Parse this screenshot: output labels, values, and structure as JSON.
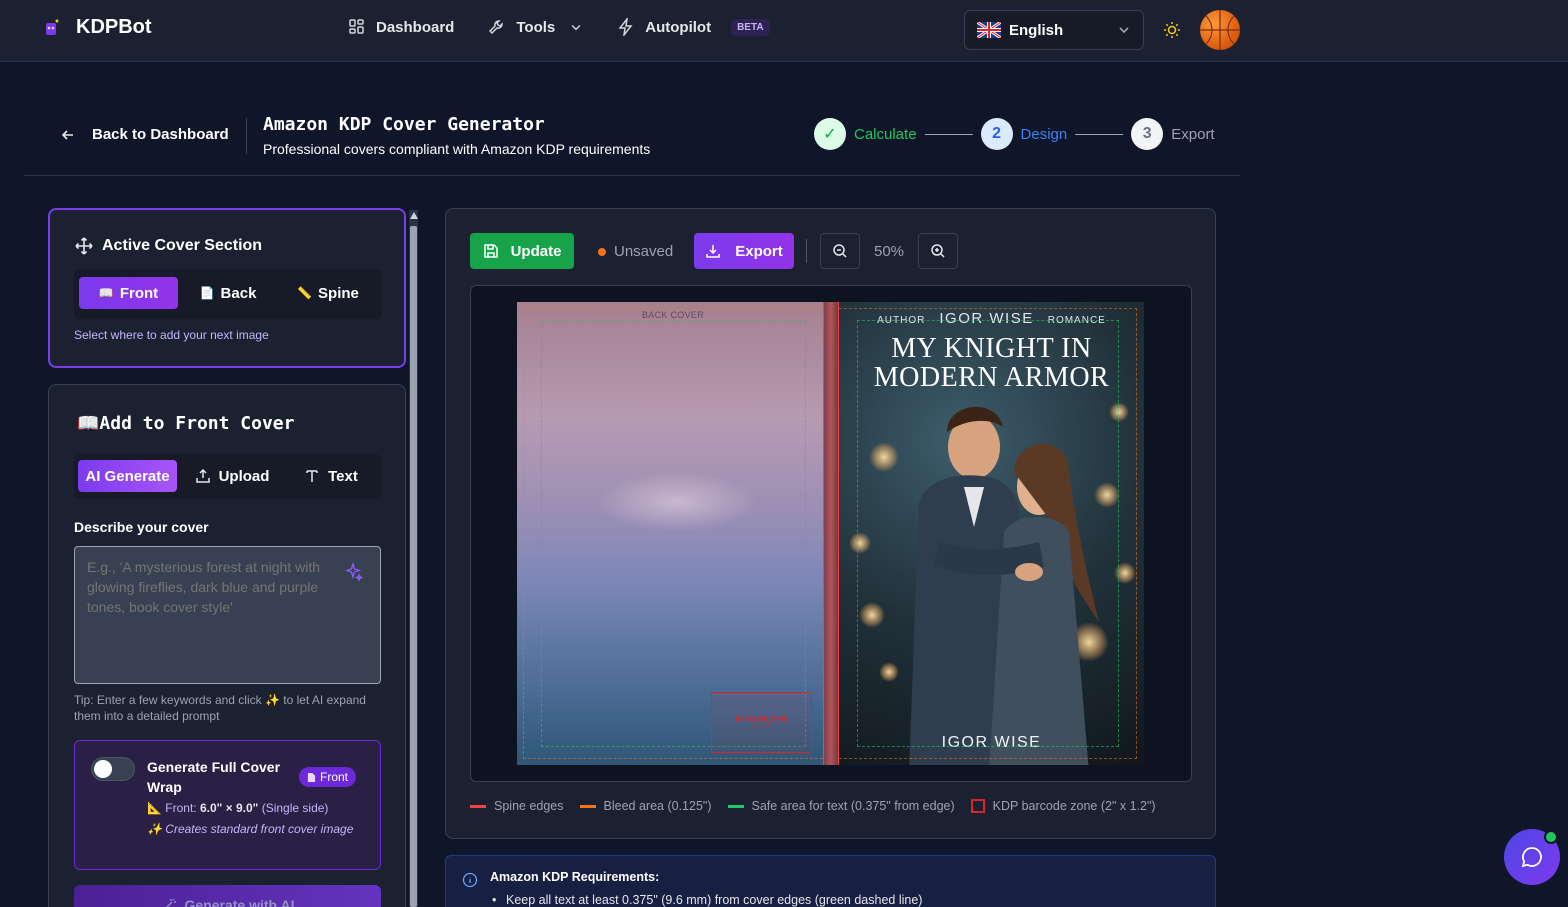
{
  "nav": {
    "brand": "KDPBot",
    "links": [
      {
        "label": "Dashboard",
        "icon": "dashboard-grid-icon"
      },
      {
        "label": "Tools",
        "icon": "wrench-icon"
      },
      {
        "label": "Autopilot",
        "icon": "lightning-icon",
        "badge": "BETA"
      }
    ],
    "language": "English",
    "theme_icon": "sun-icon"
  },
  "header": {
    "back_label": "Back to Dashboard",
    "title": "Amazon KDP Cover Generator",
    "subtitle": "Professional covers compliant with Amazon KDP requirements",
    "steps": [
      {
        "number": "✓",
        "label": "Calculate",
        "state": "done"
      },
      {
        "number": "2",
        "label": "Design",
        "state": "active"
      },
      {
        "number": "3",
        "label": "Export",
        "state": "pending"
      }
    ]
  },
  "section_card": {
    "title": "Active Cover Section",
    "tabs": [
      {
        "label": "Front",
        "emoji": "📖",
        "active": true
      },
      {
        "label": "Back",
        "emoji": "📄",
        "active": false
      },
      {
        "label": "Spine",
        "emoji": "📏",
        "active": false
      }
    ],
    "hint": "Select where to add your next image"
  },
  "add_card": {
    "title": "📖Add to Front Cover",
    "tabs": [
      {
        "label": "AI Generate",
        "active": true
      },
      {
        "label": "Upload",
        "icon": "upload-icon"
      },
      {
        "label": "Text",
        "icon": "text-icon"
      }
    ],
    "describe_label": "Describe your cover",
    "placeholder": "E.g., 'A mysterious forest at night with glowing fireflies, dark blue and purple tones, book cover style'",
    "tip": "Tip: Enter a few keywords and click ✨ to let AI expand them into a detailed prompt",
    "wrap": {
      "title": "Generate Full Cover Wrap",
      "badge": "Front",
      "dim_prefix": "📐 Front: ",
      "dim_value": "6.0\" × 9.0\"",
      "dim_suffix": " (Single side)",
      "note": "✨ Creates standard front cover image",
      "enabled": false
    },
    "generate_button": "Generate with AI"
  },
  "editor": {
    "update_label": "Update",
    "status": "Unsaved",
    "export_label": "Export",
    "zoom": "50%",
    "cover": {
      "back_label": "BACK COVER",
      "front_author_prefix": "AUTHOR",
      "front_author": "IGOR WISE",
      "front_genre": "ROMANCE",
      "book_title_line1": "MY KNIGHT IN",
      "book_title_line2": "MODERN ARMOR",
      "bottom_author": "IGOR WISE",
      "barcode_label": "BARCODE ZONE",
      "barcode_size": "2\" × 1.2\""
    },
    "legend": [
      {
        "label": "Spine edges",
        "color": "#ef4444",
        "type": "line"
      },
      {
        "label": "Bleed area (0.125\")",
        "color": "#f97316",
        "type": "line"
      },
      {
        "label": "Safe area for text (0.375\" from edge)",
        "color": "#22c55e",
        "type": "line"
      },
      {
        "label": "KDP barcode zone (2\" x 1.2\")",
        "color": "#dc2626",
        "type": "box"
      }
    ]
  },
  "requirements": {
    "title": "Amazon KDP Requirements:",
    "items": [
      "Keep all text at least 0.375\" (9.6 mm) from cover edges (green dashed line)"
    ]
  },
  "colors": {
    "accent": "#7c3aed",
    "success": "#16a34a",
    "background": "#0f1629"
  }
}
